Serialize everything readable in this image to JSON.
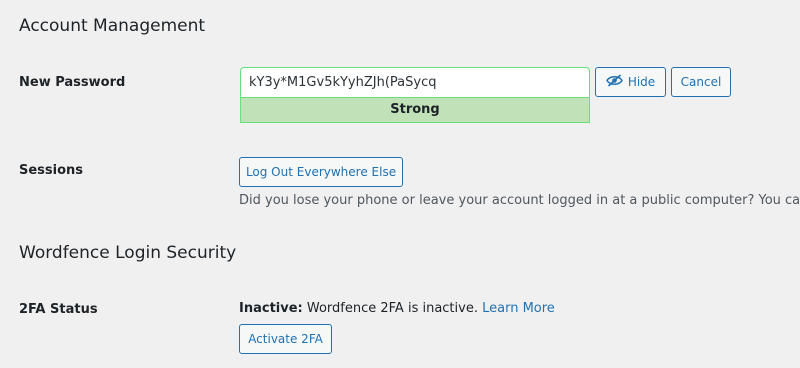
{
  "account": {
    "title": "Account Management",
    "new_password_label": "New Password",
    "password_value": "kY3y*M1Gv5kYyhZJh(PaSycq",
    "strength": "Strong",
    "hide_label": "Hide",
    "cancel_label": "Cancel",
    "sessions_label": "Sessions",
    "logout_label": "Log Out Everywhere Else",
    "sessions_description": "Did you lose your phone or leave your account logged in at a public computer? You can log"
  },
  "wordfence": {
    "title": "Wordfence Login Security",
    "status_label": "2FA Status",
    "inactive_label": "Inactive:",
    "inactive_text": " Wordfence 2FA is inactive. ",
    "learn_more": "Learn More",
    "activate_label": "Activate 2FA"
  },
  "colors": {
    "accent": "#2271b1",
    "strength_bg": "#c1e1b9",
    "strength_border": "#68de7c",
    "page_bg": "#f0f0f1"
  },
  "icons": {
    "hide": "eye-slash-icon"
  }
}
